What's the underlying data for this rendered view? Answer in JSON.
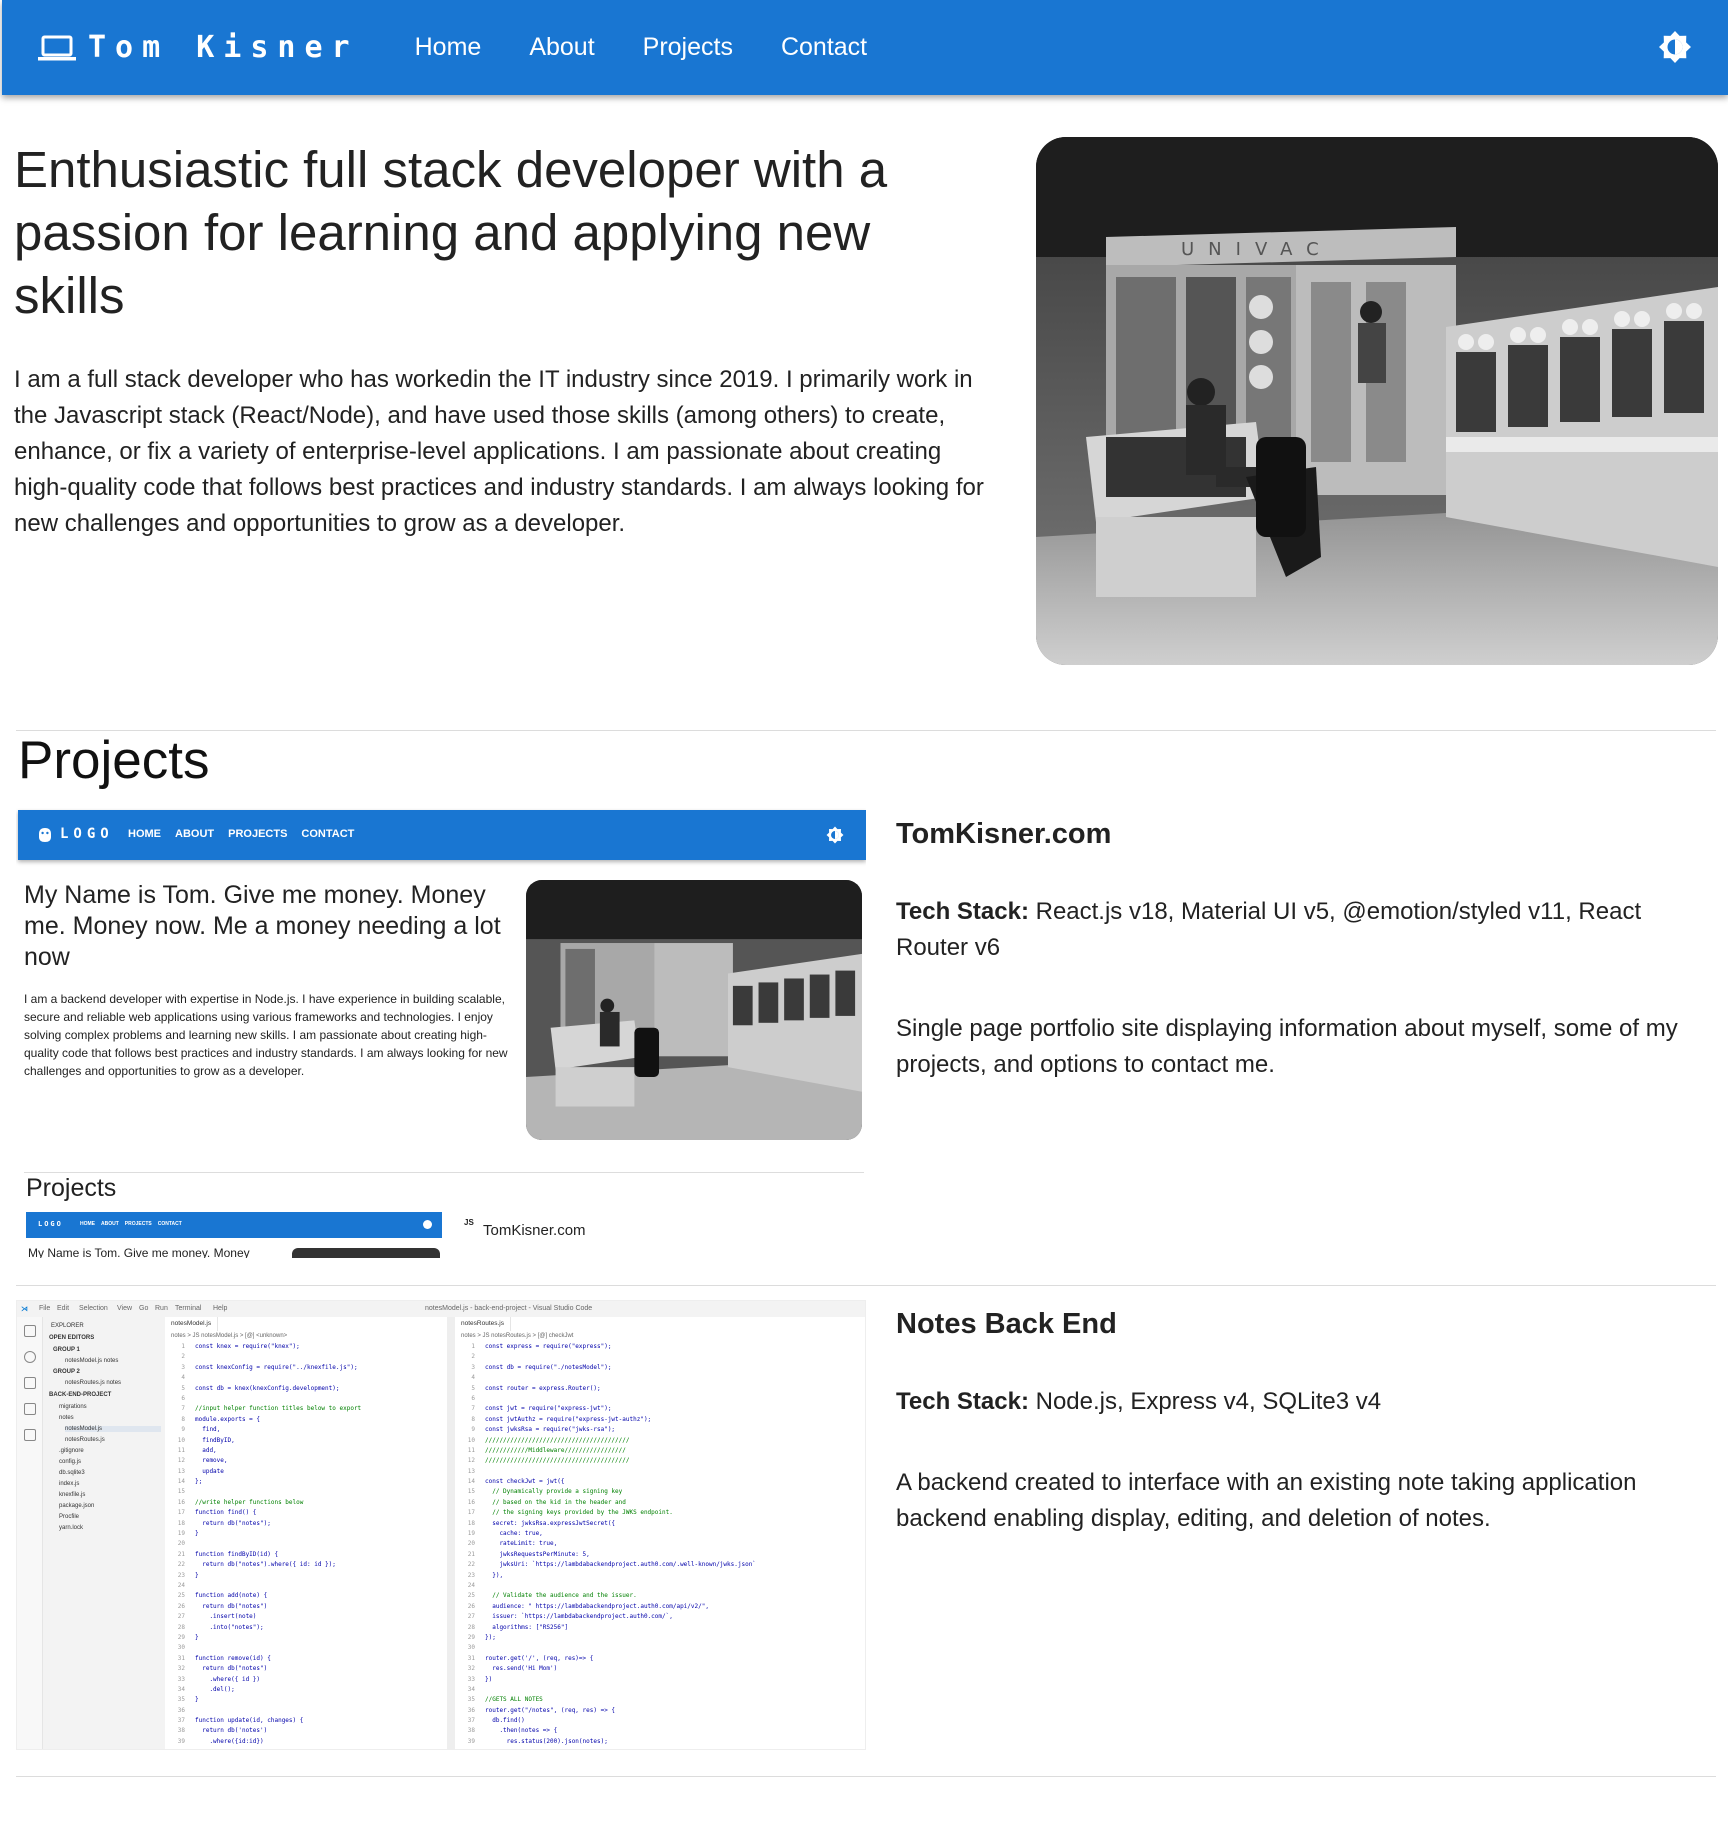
{
  "navbar": {
    "brand": "Tom Kisner",
    "links": [
      "Home",
      "About",
      "Projects",
      "Contact"
    ],
    "colors": {
      "primary": "#1976d2",
      "text": "#ffffff"
    },
    "icons": {
      "brand": "laptop-icon",
      "theme_toggle": "brightness-icon"
    }
  },
  "hero": {
    "title": "Enthusiastic full stack developer with a passion for learning and applying new skills",
    "text": "I am a full stack developer who has workedin the IT industry since 2019. I primarily work in the Javascript stack (React/Node), and have used those skills (among others) to create, enhance, or fix a variety of enterprise-level applications. I am passionate about creating high-quality code that follows best practices and industry standards. I am always looking for new challenges and opportunities to grow as a developer."
  },
  "projects": {
    "title": "Projects",
    "items": [
      {
        "name": "TomKisner.com",
        "stack_label": "Tech Stack:",
        "stack": "React.js v18, Material UI v5, @emotion/styled v11, React Router v6",
        "description": "Single page portfolio site displaying information about myself, some of my projects, and options to contact me.",
        "thumbnail": {
          "nav_logo": "LOGO",
          "nav_links": [
            "HOME",
            "ABOUT",
            "PROJECTS",
            "CONTACT"
          ],
          "title": "My Name is Tom. Give me money. Money me. Money now. Me a money needing a lot now",
          "text": "I am a backend developer with expertise in Node.js. I have experience in building scalable, secure and reliable web applications using various frameworks and technologies. I enjoy solving complex problems and learning new skills. I am passionate about creating high-quality code that follows best practices and industry standards. I am always looking for new challenges and opportunities to grow as a developer.",
          "projects_heading": "Projects",
          "mini_nav_logo": "LOGO",
          "mini_nav_links": [
            "HOME",
            "ABOUT",
            "PROJECTS",
            "CONTACT"
          ],
          "mini_title": "My Name is Tom. Give me money. Money",
          "mini_js_badge": "JS",
          "mini_project_name": "TomKisner.com"
        }
      },
      {
        "name": "Notes Back End",
        "stack_label": "Tech Stack:",
        "stack": "Node.js, Express v4, SQLite3 v4",
        "description": "A backend created to interface with an existing note taking application backend enabling display, editing, and deletion of notes.",
        "thumbnail": {
          "menu": [
            "File",
            "Edit",
            "Selection",
            "View",
            "Go",
            "Run",
            "Terminal",
            "Help"
          ],
          "window_title": "notesModel.js - back-end-project - Visual Studio Code",
          "explorer": {
            "header": "EXPLORER",
            "open_editors": "OPEN EDITORS",
            "group1": "GROUP 1",
            "group1_file": "notesModel.js notes",
            "group2": "GROUP 2",
            "group2_file": "notesRoutes.js notes",
            "project": "BACK-END-PROJECT",
            "files": [
              "migrations",
              "notes",
              "notesModel.js",
              "notesRoutes.js",
              ".gitignore",
              "config.js",
              "db.sqlite3",
              "index.js",
              "knexfile.js",
              "package.json",
              "Procfile",
              "yarn.lock"
            ]
          },
          "left_tab": "notesModel.js",
          "left_breadcrumb": "notes > JS notesModel.js > [@] <unknown>",
          "left_code": [
            "const knex = require(\"knex\");",
            "",
            "const knexConfig = require(\"../knexfile.js\");",
            "",
            "const db = knex(knexConfig.development);",
            "",
            "//input helper function titles below to export",
            "module.exports = {",
            "  find,",
            "  findByID,",
            "  add,",
            "  remove,",
            "  update",
            "};",
            "",
            "//write helper functions below",
            "function find() {",
            "  return db(\"notes\");",
            "}",
            "",
            "function findByID(id) {",
            "  return db(\"notes\").where({ id: id });",
            "}",
            "",
            "function add(note) {",
            "  return db(\"notes\")",
            "    .insert(note)",
            "    .into(\"notes\");",
            "}",
            "",
            "function remove(id) {",
            "  return db(\"notes\")",
            "    .where({ id })",
            "    .del();",
            "}",
            "",
            "function update(id, changes) {",
            "  return db('notes')",
            "    .where({id:id})"
          ],
          "right_tab": "notesRoutes.js",
          "right_breadcrumb": "notes > JS notesRoutes.js > [@] checkJwt",
          "right_code": [
            "const express = require(\"express\");",
            "",
            "const db = require(\"./notesModel\");",
            "",
            "const router = express.Router();",
            "",
            "const jwt = require(\"express-jwt\");",
            "const jwtAuthz = require(\"express-jwt-authz\");",
            "const jwksRsa = require(\"jwks-rsa\");",
            "////////////////////////////////////////",
            "////////////Middleware/////////////////",
            "////////////////////////////////////////",
            "",
            "const checkJwt = jwt({",
            "  // Dynamically provide a signing key",
            "  // based on the kid in the header and",
            "  // the signing keys provided by the JWKS endpoint.",
            "  secret: jwksRsa.expressJwtSecret({",
            "    cache: true,",
            "    rateLimit: true,",
            "    jwksRequestsPerMinute: 5,",
            "    jwksUri: `https://lambdabackendproject.auth0.com/.well-known/jwks.json`",
            "  }),",
            "",
            "  // Validate the audience and the issuer.",
            "  audience: \" https://lambdabackendproject.auth0.com/api/v2/\",",
            "  issuer: `https://lambdabackendproject.auth0.com/`,",
            "  algorithms: [\"RS256\"]",
            "});",
            "",
            "router.get('/', (req, res)=> {",
            "  res.send('Hi Mom')",
            "})",
            "",
            "//GETS ALL NOTES",
            "router.get(\"/notes\", (req, res) => {",
            "  db.find()",
            "    .then(notes => {",
            "      res.status(200).json(notes);"
          ]
        }
      }
    ]
  }
}
